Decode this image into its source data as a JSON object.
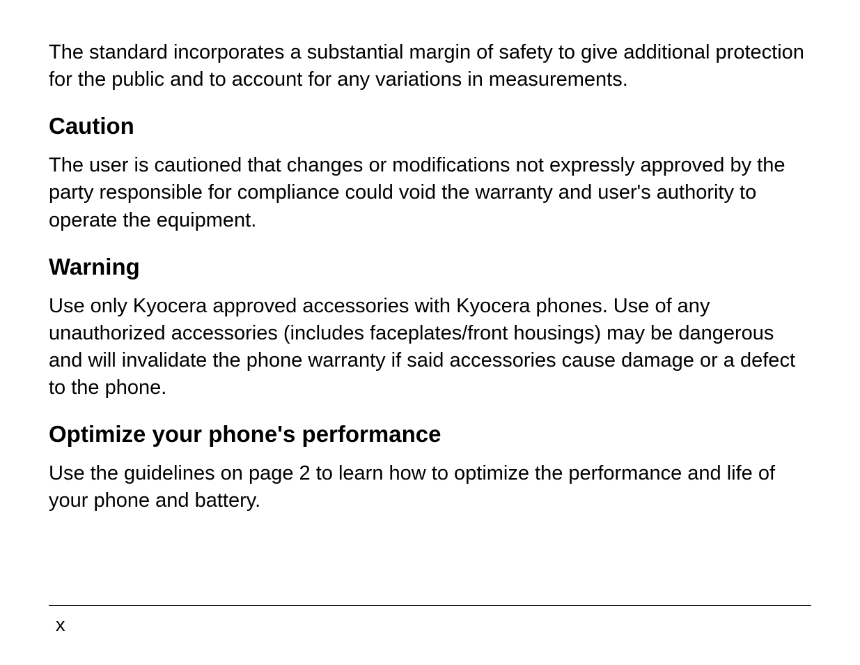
{
  "intro_paragraph": "The standard incorporates a substantial margin of safety to give additional protection for the public and to account for any variations in measurements.",
  "sections": {
    "caution": {
      "heading": "Caution",
      "body": "The user is cautioned that changes or modifications not expressly approved by the party responsible for compliance could void the warranty and user's authority to operate the equipment."
    },
    "warning": {
      "heading": "Warning",
      "body": "Use only Kyocera approved accessories with Kyocera phones. Use of any unauthorized accessories (includes faceplates/front housings) may be dangerous and will invalidate the phone warranty if said accessories cause damage or a defect to the phone."
    },
    "optimize": {
      "heading": "Optimize your phone's performance",
      "body": "Use the guidelines on page 2 to learn how to optimize the performance and life of your phone and battery."
    }
  },
  "page_number": "x"
}
